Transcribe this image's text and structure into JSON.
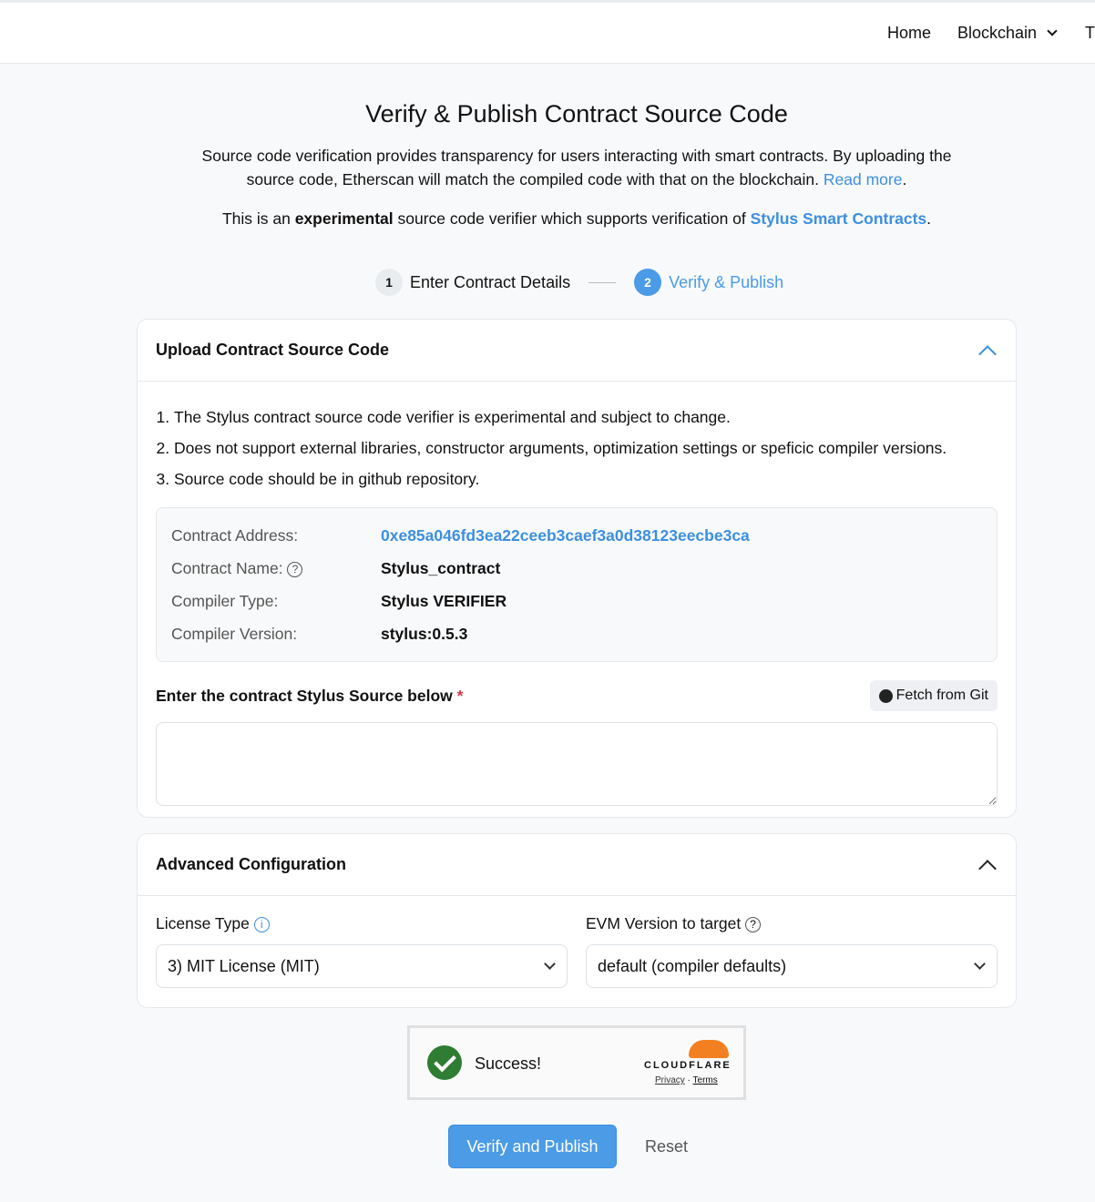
{
  "nav": {
    "items": [
      "Home",
      "Blockchain",
      "T"
    ]
  },
  "page": {
    "title": "Verify & Publish Contract Source Code",
    "desc": "Source code verification provides transparency for users interacting with smart contracts. By uploading the source code, Etherscan will match the compiled code with that on the blockchain.",
    "read_more": "Read more",
    "exp_pre": "This is an ",
    "exp_bold": "experimental",
    "exp_mid": " source code verifier which supports verification of ",
    "exp_link": "Stylus Smart Contracts"
  },
  "steps": [
    {
      "num": "1",
      "label": "Enter Contract Details"
    },
    {
      "num": "2",
      "label": "Verify & Publish"
    }
  ],
  "upload": {
    "title": "Upload Contract Source Code",
    "notes": [
      "The Stylus contract source code verifier is experimental and subject to change.",
      "Does not support external libraries, constructor arguments, optimization settings or speficic compiler versions.",
      "Source code should be in github repository."
    ],
    "info": [
      {
        "k": "Contract Address:",
        "v": "0xe85a046fd3ea22ceeb3caef3a0d38123eecbe3ca"
      },
      {
        "k": "Contract Name:",
        "v": "Stylus_contract"
      },
      {
        "k": "Compiler Type:",
        "v": "Stylus VERIFIER"
      },
      {
        "k": "Compiler Version:",
        "v": "stylus:0.5.3"
      }
    ],
    "source_label": "Enter the contract Stylus Source below",
    "required": "*",
    "fetch": "Fetch from Git",
    "source_value": ""
  },
  "advanced": {
    "title": "Advanced Configuration",
    "license_label": "License Type",
    "license_value": "3) MIT License (MIT)",
    "evm_label": "EVM Version to target",
    "evm_value": "default (compiler defaults)"
  },
  "captcha": {
    "status": "Success!",
    "brand": "CLOUDFLARE",
    "privacy": "Privacy",
    "sep": "·",
    "terms": "Terms"
  },
  "actions": {
    "verify": "Verify and Publish",
    "reset": "Reset"
  },
  "colors": {
    "accent": "#4b9be6",
    "link": "#3d8fe0",
    "success": "#2e7d32",
    "cloudflare": "#f38020"
  }
}
